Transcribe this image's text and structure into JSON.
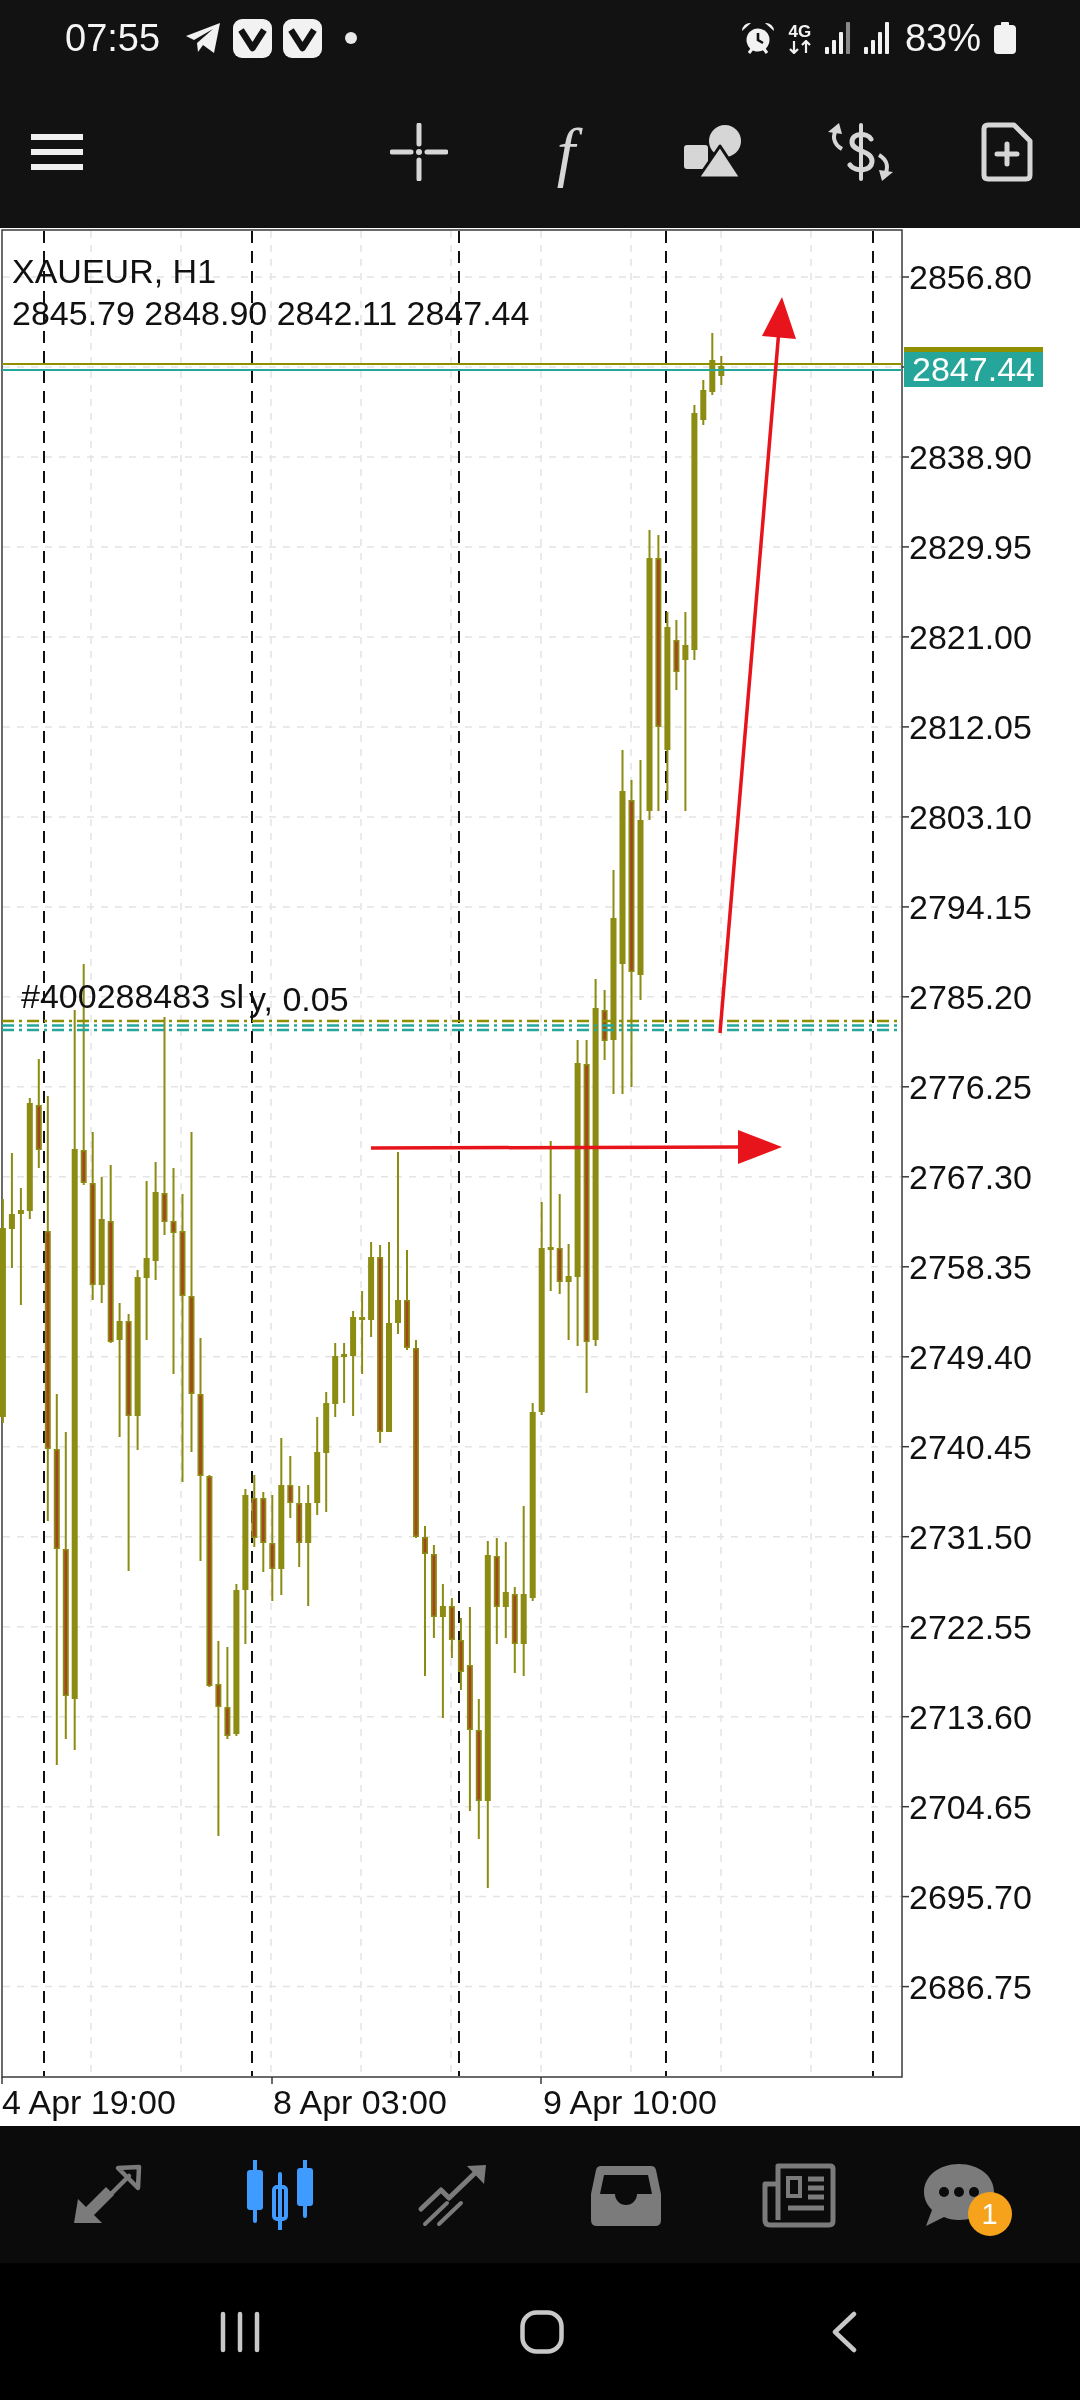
{
  "status_bar": {
    "time": "07:55",
    "network_type": "4G",
    "battery": "83%"
  },
  "toolbar": {
    "function_glyph": "f"
  },
  "chart": {
    "symbol": "XAUEUR, H1",
    "ohlc": "2845.79 2848.90 2842.11 2847.44",
    "current_price": "2847.44",
    "order_labels": [
      "#400288483 sl",
      "y, 0.05"
    ],
    "price_labels": [
      "2856.80",
      "2838.90",
      "2829.95",
      "2821.00",
      "2812.05",
      "2803.10",
      "2794.15",
      "2785.20",
      "2776.25",
      "2767.30",
      "2758.35",
      "2749.40",
      "2740.45",
      "2731.50",
      "2722.55",
      "2713.60",
      "2704.65",
      "2695.70",
      "2686.75"
    ],
    "time_labels": [
      "4 Apr 19:00",
      "8 Apr 03:00",
      "9 Apr 10:00"
    ]
  },
  "bottom_nav": [
    {
      "selected": false
    },
    {
      "selected": true
    },
    {
      "selected": false
    },
    {
      "selected": false
    },
    {
      "selected": false
    },
    {
      "selected": false,
      "badge": "1"
    }
  ]
}
